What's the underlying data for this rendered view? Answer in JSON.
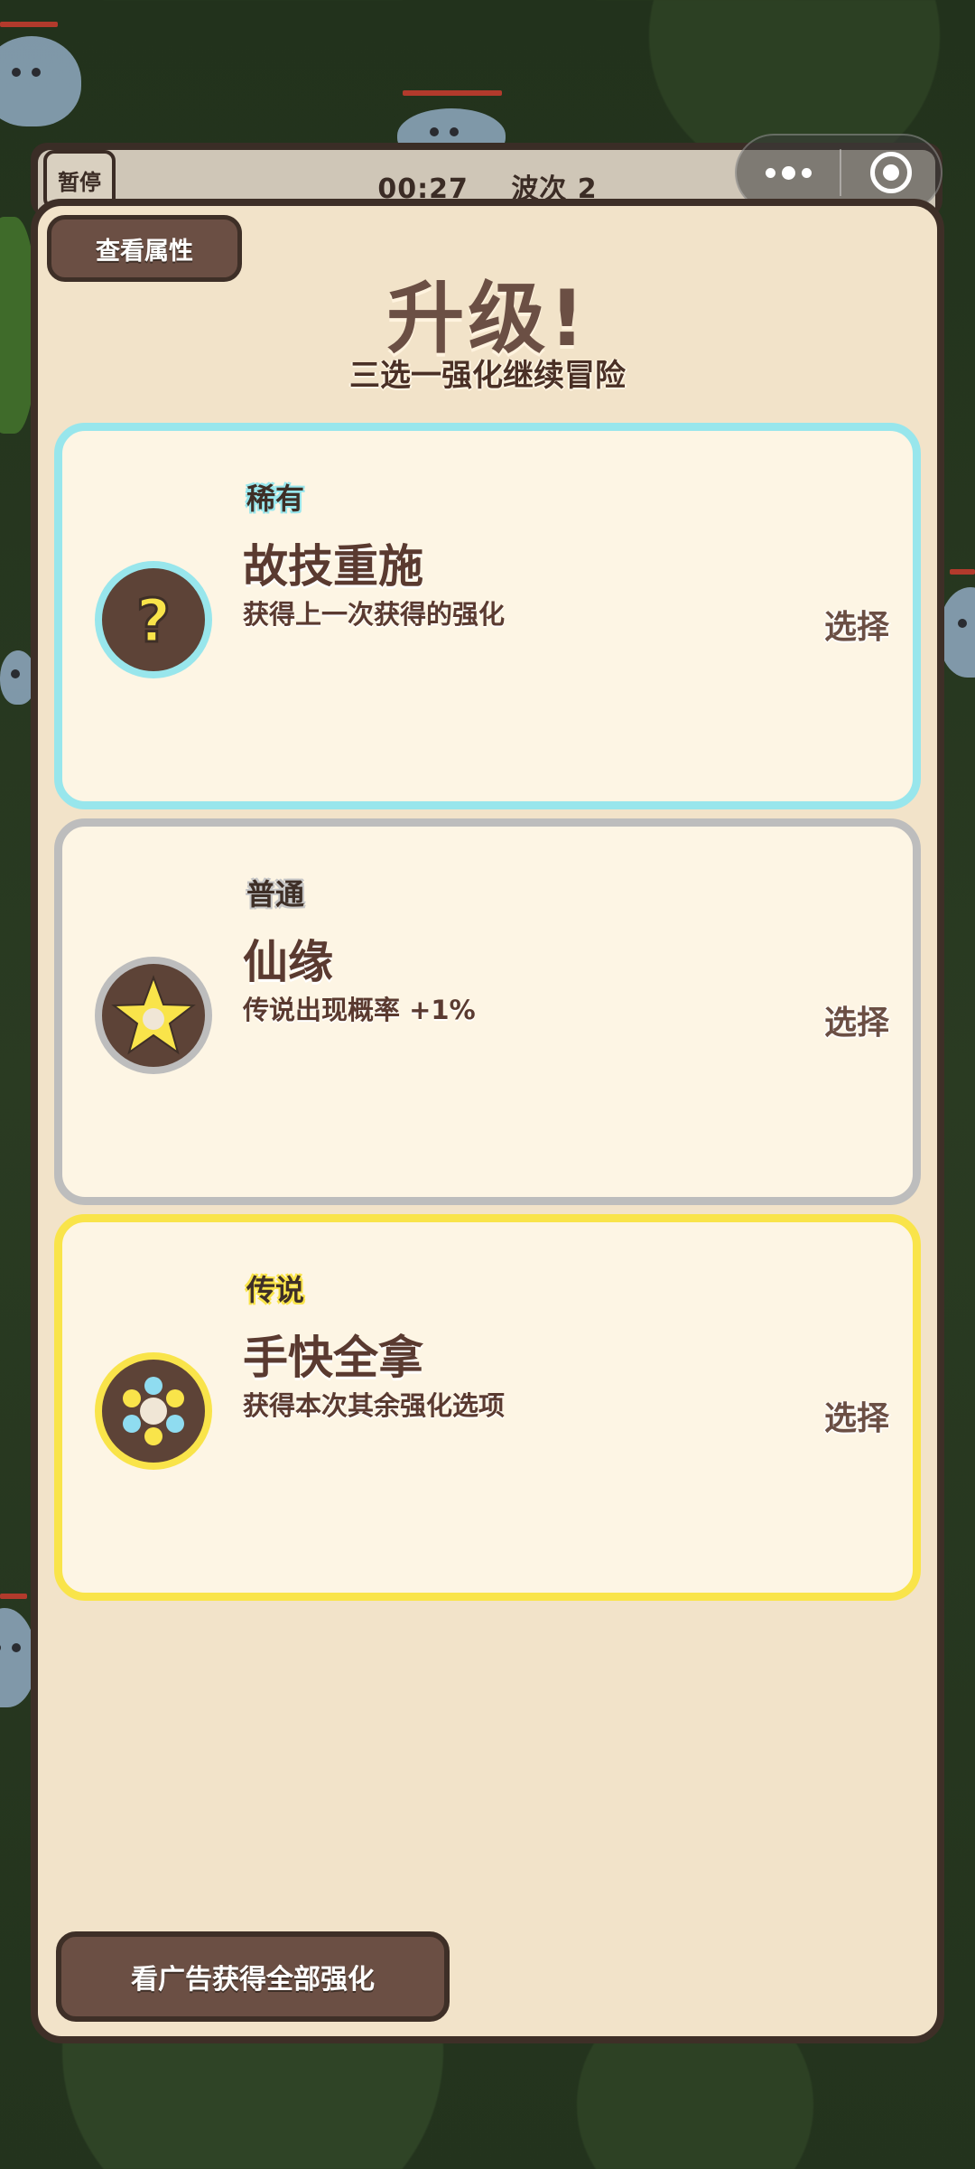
{
  "hud": {
    "pause_label": "暂停",
    "timer": "00:27",
    "wave": "波次 2"
  },
  "capsule": {
    "more_icon": "more-dots-icon",
    "close_icon": "target-circle-icon"
  },
  "panel": {
    "view_attributes_label": "查看属性",
    "title": "升级!",
    "subtitle": "三选一强化继续冒险",
    "ad_button_label": "看广告获得全部强化"
  },
  "cards": [
    {
      "rarity": "稀有",
      "name": "故技重施",
      "description": "获得上一次获得的强化",
      "choose_label": "选择",
      "icon": "question-mark-icon",
      "border_color": "#98e6ec"
    },
    {
      "rarity": "普通",
      "name": "仙缘",
      "description": "传说出现概率 +1%",
      "choose_label": "选择",
      "icon": "star-icon",
      "border_color": "#bdbdbd"
    },
    {
      "rarity": "传说",
      "name": "手快全拿",
      "description": "获得本次其余强化选项",
      "choose_label": "选择",
      "icon": "flower-dots-icon",
      "border_color": "#f9e44a"
    }
  ],
  "colors": {
    "panel_bg": "#f2e3c9",
    "panel_border": "#3e2f27",
    "button_brown": "#6b4f44",
    "rare": "#98e6ec",
    "normal": "#bdbdbd",
    "legendary": "#f9e44a"
  }
}
